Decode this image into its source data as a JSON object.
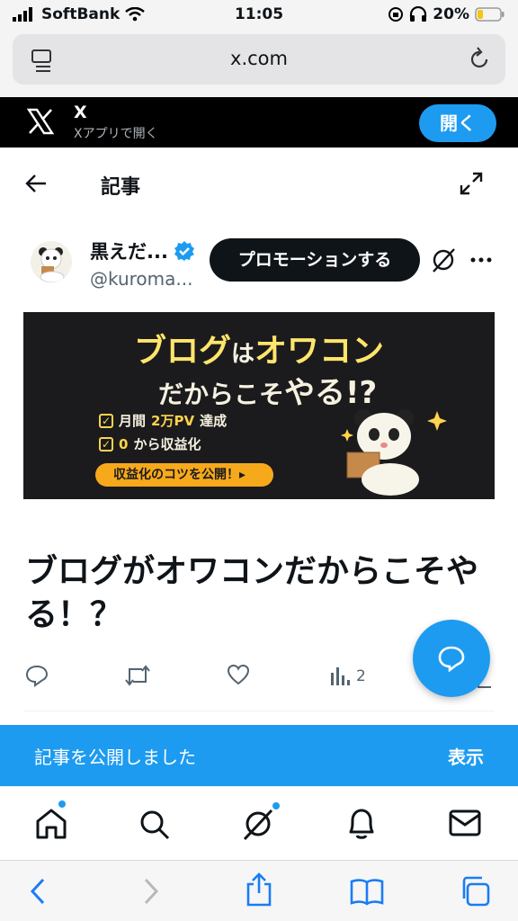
{
  "status_bar": {
    "carrier": "SoftBank",
    "time": "11:05",
    "battery": "20%"
  },
  "browser": {
    "url": "x.com"
  },
  "app_banner": {
    "app_name": "X",
    "subtitle": "Xアプリで開く",
    "open_label": "開く"
  },
  "article_header": {
    "title": "記事"
  },
  "author": {
    "name": "黒えだ...",
    "handle": "@kuroma...",
    "promote_label": "プロモーションする"
  },
  "banner_image": {
    "headline_part1": "ブログ",
    "headline_part2": "は",
    "headline_part3": "オワコン",
    "subhead_part1": "だからこそ",
    "subhead_part2": "やる!?",
    "feature1_prefix": "月間",
    "feature1_highlight": "2万PV",
    "feature1_suffix": "達成",
    "feature2_prefix": "0",
    "feature2_suffix": "から収益化",
    "cta": "収益化のコツを公開！▸"
  },
  "article": {
    "title": "ブログがオワコンだからこそやる！？"
  },
  "actions": {
    "views_count": "2"
  },
  "toast": {
    "message": "記事を公開しました",
    "action": "表示"
  },
  "colors": {
    "accent": "#1d9bf0",
    "text": "#0f1419",
    "secondary_text": "#536471"
  },
  "icons": {
    "back": "arrow-left-icon",
    "expand": "expand-icon",
    "verified": "verified-badge-icon",
    "grok": "grok-icon",
    "more": "more-dots-icon",
    "reply": "reply-icon",
    "repost": "repost-icon",
    "like": "heart-icon",
    "views": "views-icon",
    "compose": "compose-icon",
    "home": "home-icon",
    "search": "search-icon",
    "notifications": "bell-icon",
    "messages": "mail-icon"
  }
}
